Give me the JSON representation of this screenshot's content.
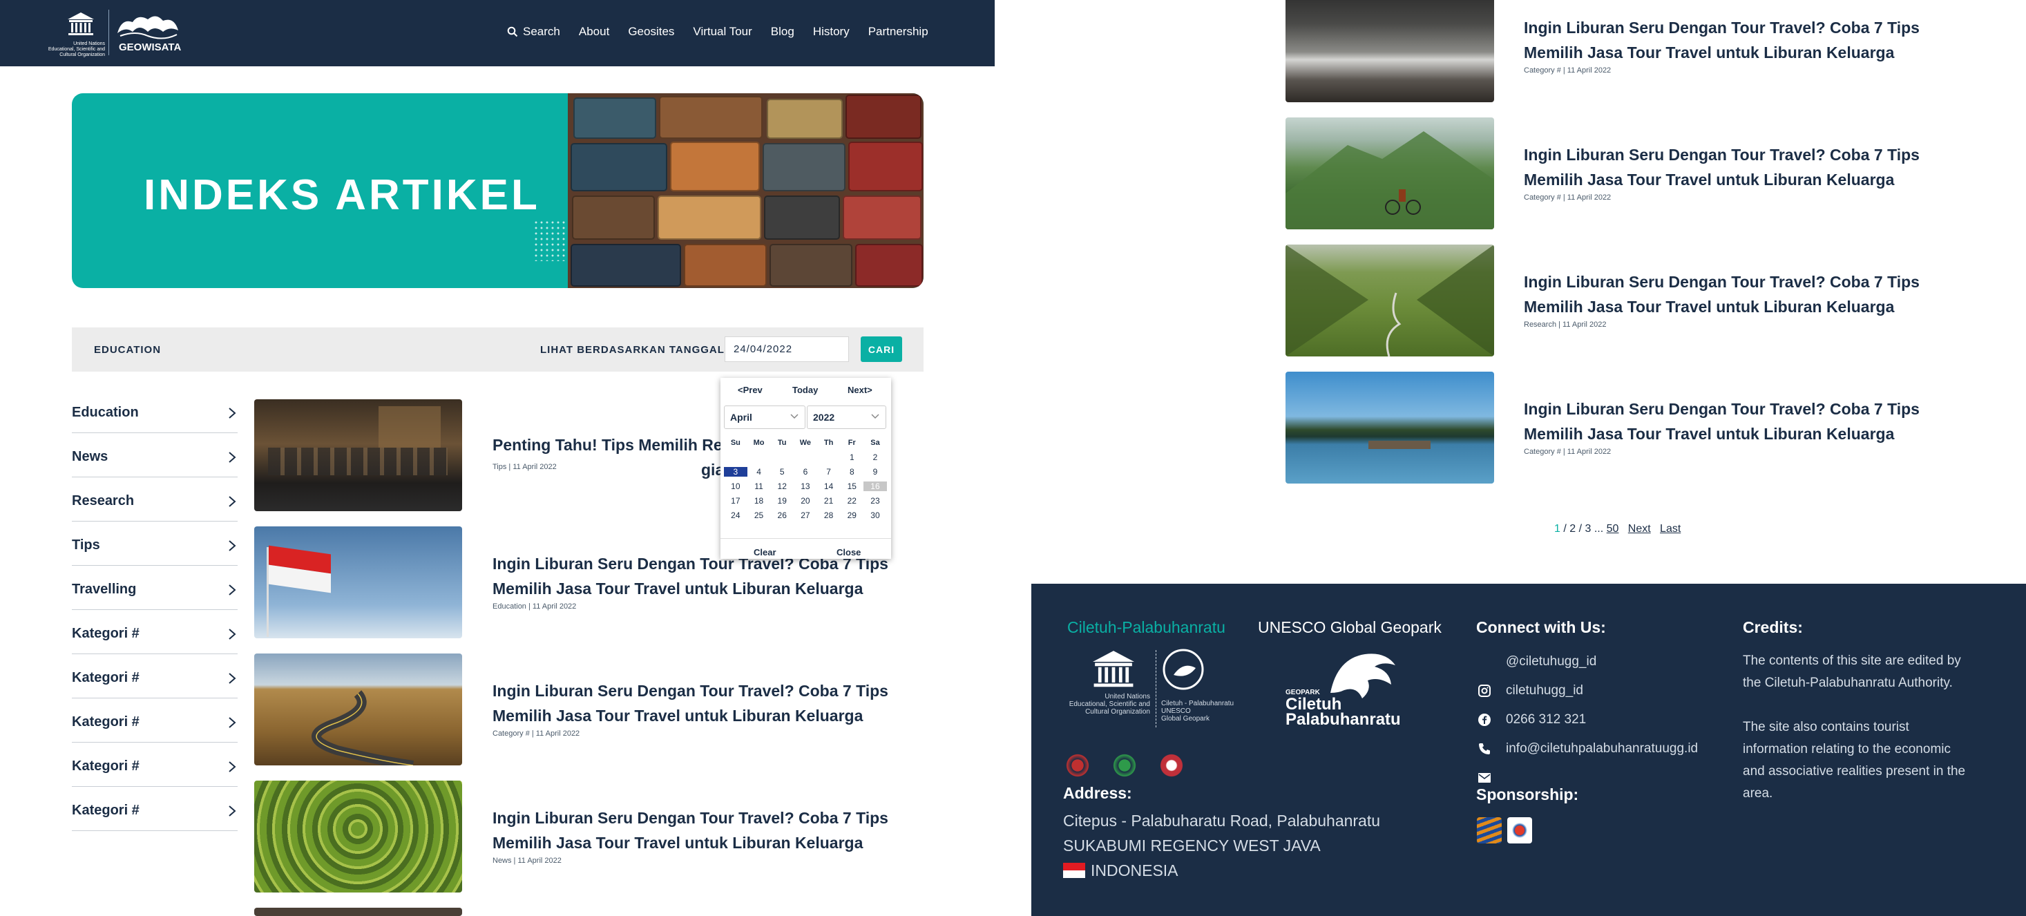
{
  "nav": {
    "logo_unesco_text": "United Nations\nEducational, Scientific and\nCultural Organization",
    "logo_geo_text": "GEOWISATA",
    "links": [
      "Search",
      "About",
      "Geosites",
      "Virtual Tour",
      "Blog",
      "History",
      "Partnership"
    ]
  },
  "hero": {
    "title": "INDEKS ARTIKEL"
  },
  "filter": {
    "category": "EDUCATION",
    "date_label": "LIHAT BERDASARKAN TANGGAL",
    "date_value": "24/04/2022",
    "search_button": "CARI"
  },
  "sidebar": {
    "categories": [
      "Education",
      "News",
      "Research",
      "Tips",
      "Travelling",
      "Kategori #",
      "Kategori #",
      "Kategori #",
      "Kategori #",
      "Kategori #"
    ]
  },
  "articles": [
    {
      "title": "Penting Tahu! Tips Memilih Restoran yang Tepat untuk Liburan Keluarga",
      "title_visible": "Penting Tahu! Tips Memilih Res",
      "title_tail": "gian",
      "meta": "Tips | 11 April 2022"
    },
    {
      "title": "Ingin Liburan Seru Dengan Tour Travel? Coba 7 Tips Memilih Jasa Tour Travel untuk Liburan Keluarga",
      "meta": "Education | 11 April 2022"
    },
    {
      "title": "Ingin Liburan Seru Dengan Tour Travel? Coba 7 Tips Memilih Jasa Tour Travel untuk Liburan Keluarga",
      "meta": "Category # | 11 April 2022"
    },
    {
      "title": "Ingin Liburan Seru Dengan Tour Travel? Coba 7 Tips Memilih Jasa Tour Travel untuk Liburan Keluarga",
      "meta": "News | 11 April 2022"
    }
  ],
  "right_articles": [
    {
      "title": "Ingin Liburan Seru Dengan Tour Travel? Coba 7 Tips Memilih Jasa Tour Travel untuk Liburan Keluarga",
      "meta": "Category # | 11 April 2022"
    },
    {
      "title": "Ingin Liburan Seru Dengan Tour Travel? Coba 7 Tips Memilih Jasa Tour Travel untuk Liburan Keluarga",
      "meta": "Category # | 11 April 2022"
    },
    {
      "title": "Ingin Liburan Seru Dengan Tour Travel? Coba 7 Tips Memilih Jasa Tour Travel untuk Liburan Keluarga",
      "meta": "Research | 11 April 2022"
    },
    {
      "title": "Ingin Liburan Seru Dengan Tour Travel? Coba 7 Tips Memilih Jasa Tour Travel untuk Liburan Keluarga",
      "meta": "Category # | 11 April 2022"
    }
  ],
  "calendar": {
    "prev": "<Prev",
    "today": "Today",
    "next": "Next>",
    "month": "April",
    "year": "2022",
    "weekdays": [
      "Su",
      "Mo",
      "Tu",
      "We",
      "Th",
      "Fr",
      "Sa"
    ],
    "weeks": [
      [
        "",
        "",
        "",
        "",
        "",
        "1",
        "2"
      ],
      [
        "3",
        "4",
        "5",
        "6",
        "7",
        "8",
        "9"
      ],
      [
        "10",
        "11",
        "12",
        "13",
        "14",
        "15",
        "16"
      ],
      [
        "17",
        "18",
        "19",
        "20",
        "21",
        "22",
        "23"
      ],
      [
        "24",
        "25",
        "26",
        "27",
        "28",
        "29",
        "30"
      ]
    ],
    "selected_day": "3",
    "highlighted_day": "16",
    "clear": "Clear",
    "close": "Close"
  },
  "pagination": {
    "current": "1",
    "pages": [
      "2",
      "3"
    ],
    "ellipsis": "...",
    "last_page": "50",
    "next": "Next",
    "last": "Last"
  },
  "footer": {
    "site_title": "Ciletuh-Palabuhanratu",
    "geopark_title": "UNESCO Global Geopark",
    "logo1_left": "United Nations\nEducational, Scientific and\nCultural Organization",
    "logo1_right": "Ciletuh - Palabuhanratu\nUNESCO\nGlobal Geopark",
    "logo2_small": "GEOPARK",
    "logo2_big": "Ciletuh\nPalabuhanratu",
    "address_heading": "Address:",
    "address_lines": [
      "Citepus - Palabuharatu Road, Palabuhanratu",
      "SUKABUMI REGENCY WEST JAVA",
      "INDONESIA"
    ],
    "connect_heading": "Connect with Us:",
    "connect": [
      {
        "icon": "twitter-icon",
        "text": "@ciletuhugg_id"
      },
      {
        "icon": "instagram-icon",
        "text": "ciletuhugg_id"
      },
      {
        "icon": "facebook-icon",
        "text": "0266 312 321"
      },
      {
        "icon": "phone-icon",
        "text": "info@ciletuhpalabuhanratuugg.id"
      },
      {
        "icon": "mail-icon",
        "text": ""
      }
    ],
    "sponsorship_heading": "Sponsorship:",
    "credits_heading": "Credits:",
    "credits_text": [
      "The contents of this site are edited by the Ciletuh-Palabuhanratu Authority.",
      "The site also contains tourist information relating to the economic and associative realities present in the area."
    ]
  },
  "colors": {
    "navy": "#1b2d45",
    "teal": "#0ab0a4",
    "calendar_selected": "#1f3f99"
  }
}
